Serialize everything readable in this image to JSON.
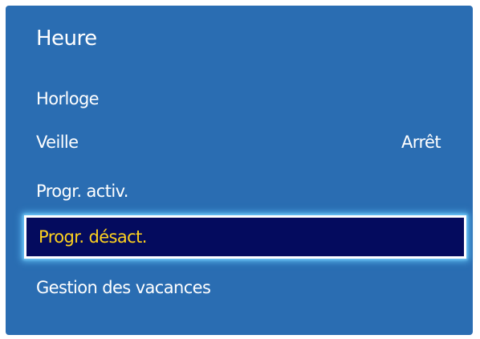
{
  "menu": {
    "title": "Heure",
    "items": [
      {
        "label": "Horloge",
        "value": ""
      },
      {
        "label": "Veille",
        "value": "Arrêt"
      },
      {
        "label": "Progr. activ.",
        "value": ""
      },
      {
        "label": "Progr. désact.",
        "value": "",
        "selected": true
      },
      {
        "label": "Gestion des vacances",
        "value": ""
      }
    ]
  },
  "colors": {
    "panel_background": "#2a6db2",
    "text": "#ffffff",
    "selected_background": "#040b5e",
    "selected_text": "#ffd21e",
    "selected_glow": "#5fc0f5"
  }
}
